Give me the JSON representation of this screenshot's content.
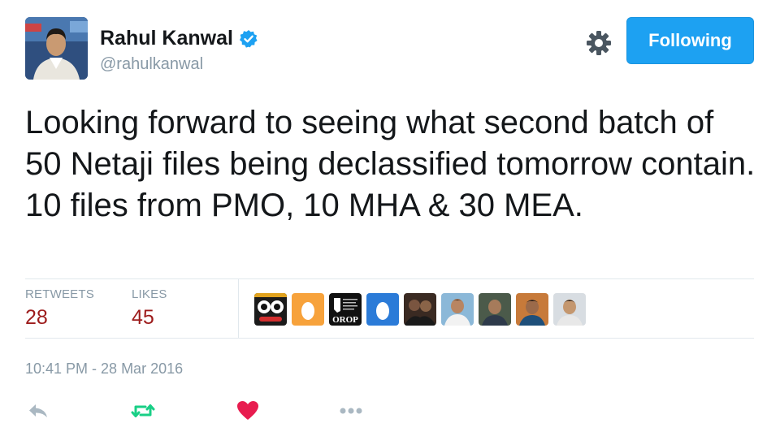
{
  "author": {
    "name": "Rahul Kanwal",
    "handle": "@rahulkanwal",
    "verified_icon": "verified-badge-icon"
  },
  "header": {
    "settings_icon": "gear-icon",
    "follow_button_label": "Following"
  },
  "tweet": {
    "text": "Looking forward to seeing what second batch of 50 Netaji files being declassified tomorrow contain. 10 files from PMO, 10 MHA & 30 MEA."
  },
  "stats": {
    "retweets_label": "RETWEETS",
    "retweets_count": "28",
    "likes_label": "LIKES",
    "likes_count": "45"
  },
  "likers": [
    {
      "name": "liker-avatar-jagannath",
      "label": ""
    },
    {
      "name": "liker-avatar-egg",
      "label": ""
    },
    {
      "name": "liker-avatar-orop",
      "label": "OROP"
    },
    {
      "name": "liker-avatar-egg",
      "label": ""
    },
    {
      "name": "liker-avatar-photo",
      "label": ""
    },
    {
      "name": "liker-avatar-photo",
      "label": ""
    },
    {
      "name": "liker-avatar-photo",
      "label": ""
    },
    {
      "name": "liker-avatar-photo",
      "label": ""
    },
    {
      "name": "liker-avatar-photo",
      "label": ""
    }
  ],
  "timestamp": "10:41 PM - 28 Mar 2016",
  "actions": {
    "reply_icon": "reply-icon",
    "retweet_icon": "retweet-icon",
    "like_icon": "heart-icon",
    "more_icon": "more-dots-icon"
  },
  "colors": {
    "accent": "#1da1f2",
    "stat_value": "#9d1c1c",
    "retweet_green": "#19cf86",
    "like_red": "#e81c4f",
    "muted": "#8899a6",
    "egg_orange": "#f7a23b",
    "egg_blue": "#2b7bd8"
  }
}
